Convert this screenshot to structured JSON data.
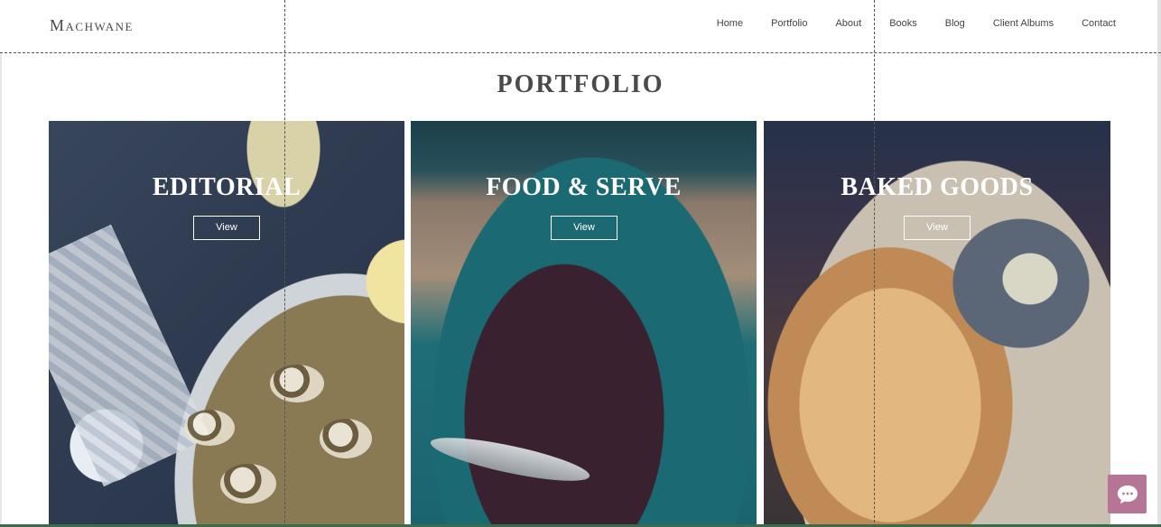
{
  "site": {
    "logo": "Machwane"
  },
  "nav": {
    "items": [
      {
        "label": "Home"
      },
      {
        "label": "Portfolio"
      },
      {
        "label": "About"
      },
      {
        "label": "Books"
      },
      {
        "label": "Blog"
      },
      {
        "label": "Client Albums"
      },
      {
        "label": "Contact"
      }
    ]
  },
  "page": {
    "title": "PORTFOLIO"
  },
  "cards": [
    {
      "title": "EDITORIAL",
      "button": "View"
    },
    {
      "title": "FOOD & SERVE",
      "button": "View"
    },
    {
      "title": "BAKED GOODS",
      "button": "View"
    }
  ],
  "chat": {
    "icon": "chat-bubble-icon",
    "color": "#b77595"
  }
}
